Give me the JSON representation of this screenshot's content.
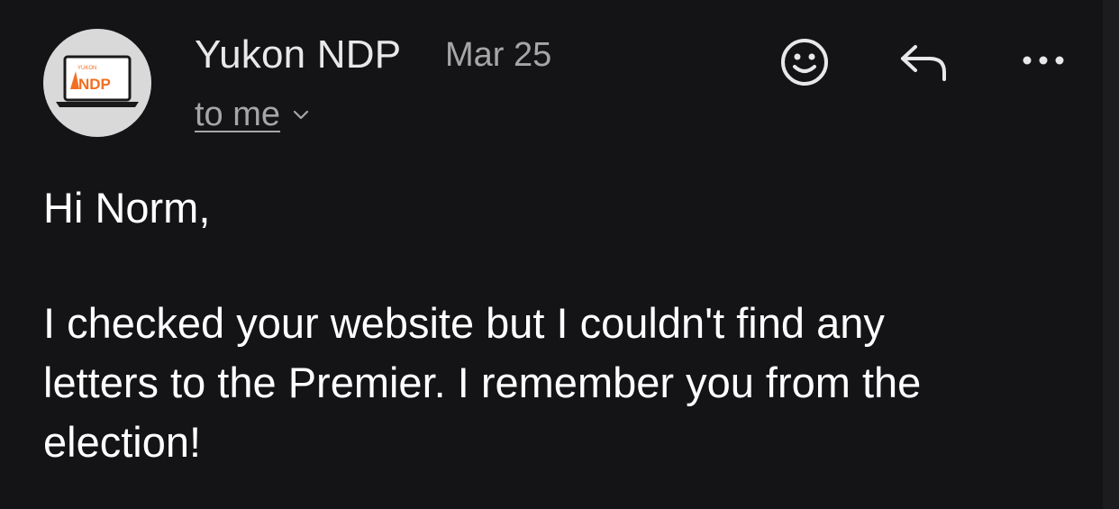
{
  "message": {
    "sender": "Yukon NDP",
    "date": "Mar 25",
    "recipient": "to me",
    "greeting": "Hi Norm,",
    "body_lines": [
      "I checked your website but I couldn't find any",
      "letters to the Premier. I remember you from the",
      "election!"
    ]
  },
  "avatar": {
    "logo_small_text": "YUKON",
    "logo_text": "NDP",
    "logo_color": "#f26f21"
  },
  "actions": {
    "emoji_icon": "smiley-face-icon",
    "reply_icon": "reply-arrow-icon",
    "more_icon": "more-horizontal-icon",
    "chevron_icon": "chevron-down-icon"
  },
  "colors": {
    "background": "#141316",
    "primary_text": "#ffffff",
    "secondary_text": "#a6a6a8",
    "avatar_bg": "#d9d9d9"
  }
}
